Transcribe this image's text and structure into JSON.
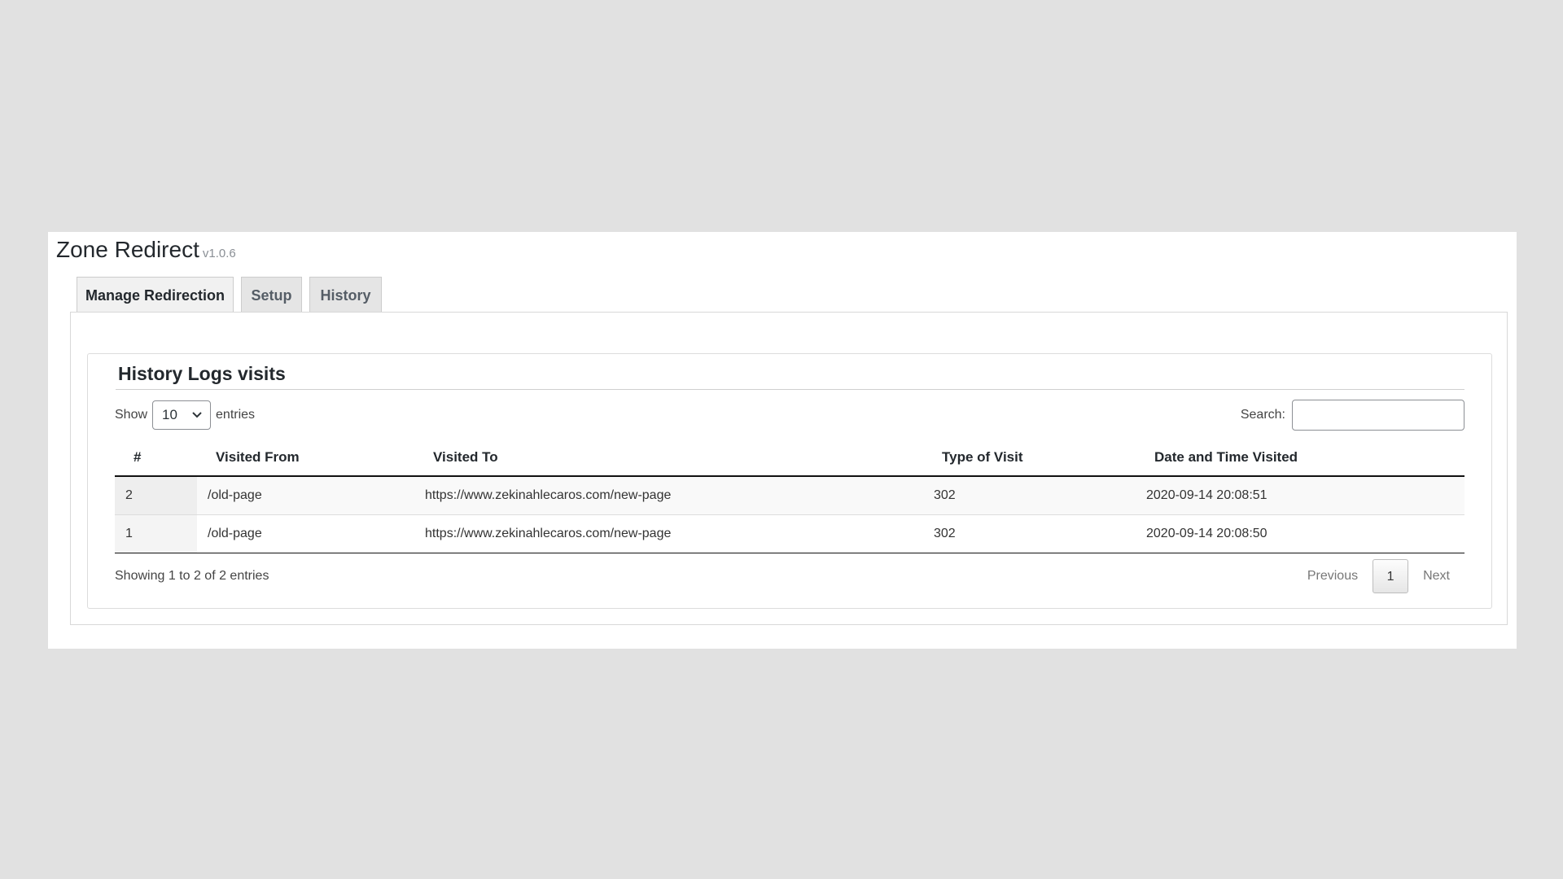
{
  "app": {
    "title": "Zone Redirect",
    "version": "v1.0.6"
  },
  "tabs": [
    {
      "label": "Manage Redirection",
      "active": true
    },
    {
      "label": "Setup",
      "active": false
    },
    {
      "label": "History",
      "active": false
    }
  ],
  "card": {
    "title": "History Logs visits"
  },
  "length_menu": {
    "show_label": "Show",
    "selected": "10",
    "entries_label": "entries"
  },
  "search": {
    "label": "Search:",
    "value": ""
  },
  "table": {
    "columns": [
      "#",
      "Visited From",
      "Visited To",
      "Type of Visit",
      "Date and Time Visited"
    ],
    "rows": [
      [
        "2",
        "/old-page",
        "https://www.zekinahlecaros.com/new-page",
        "302",
        "2020-09-14 20:08:51"
      ],
      [
        "1",
        "/old-page",
        "https://www.zekinahlecaros.com/new-page",
        "302",
        "2020-09-14 20:08:50"
      ]
    ]
  },
  "info": "Showing 1 to 2 of 2 entries",
  "pagination": {
    "previous": "Previous",
    "current": "1",
    "next": "Next"
  }
}
